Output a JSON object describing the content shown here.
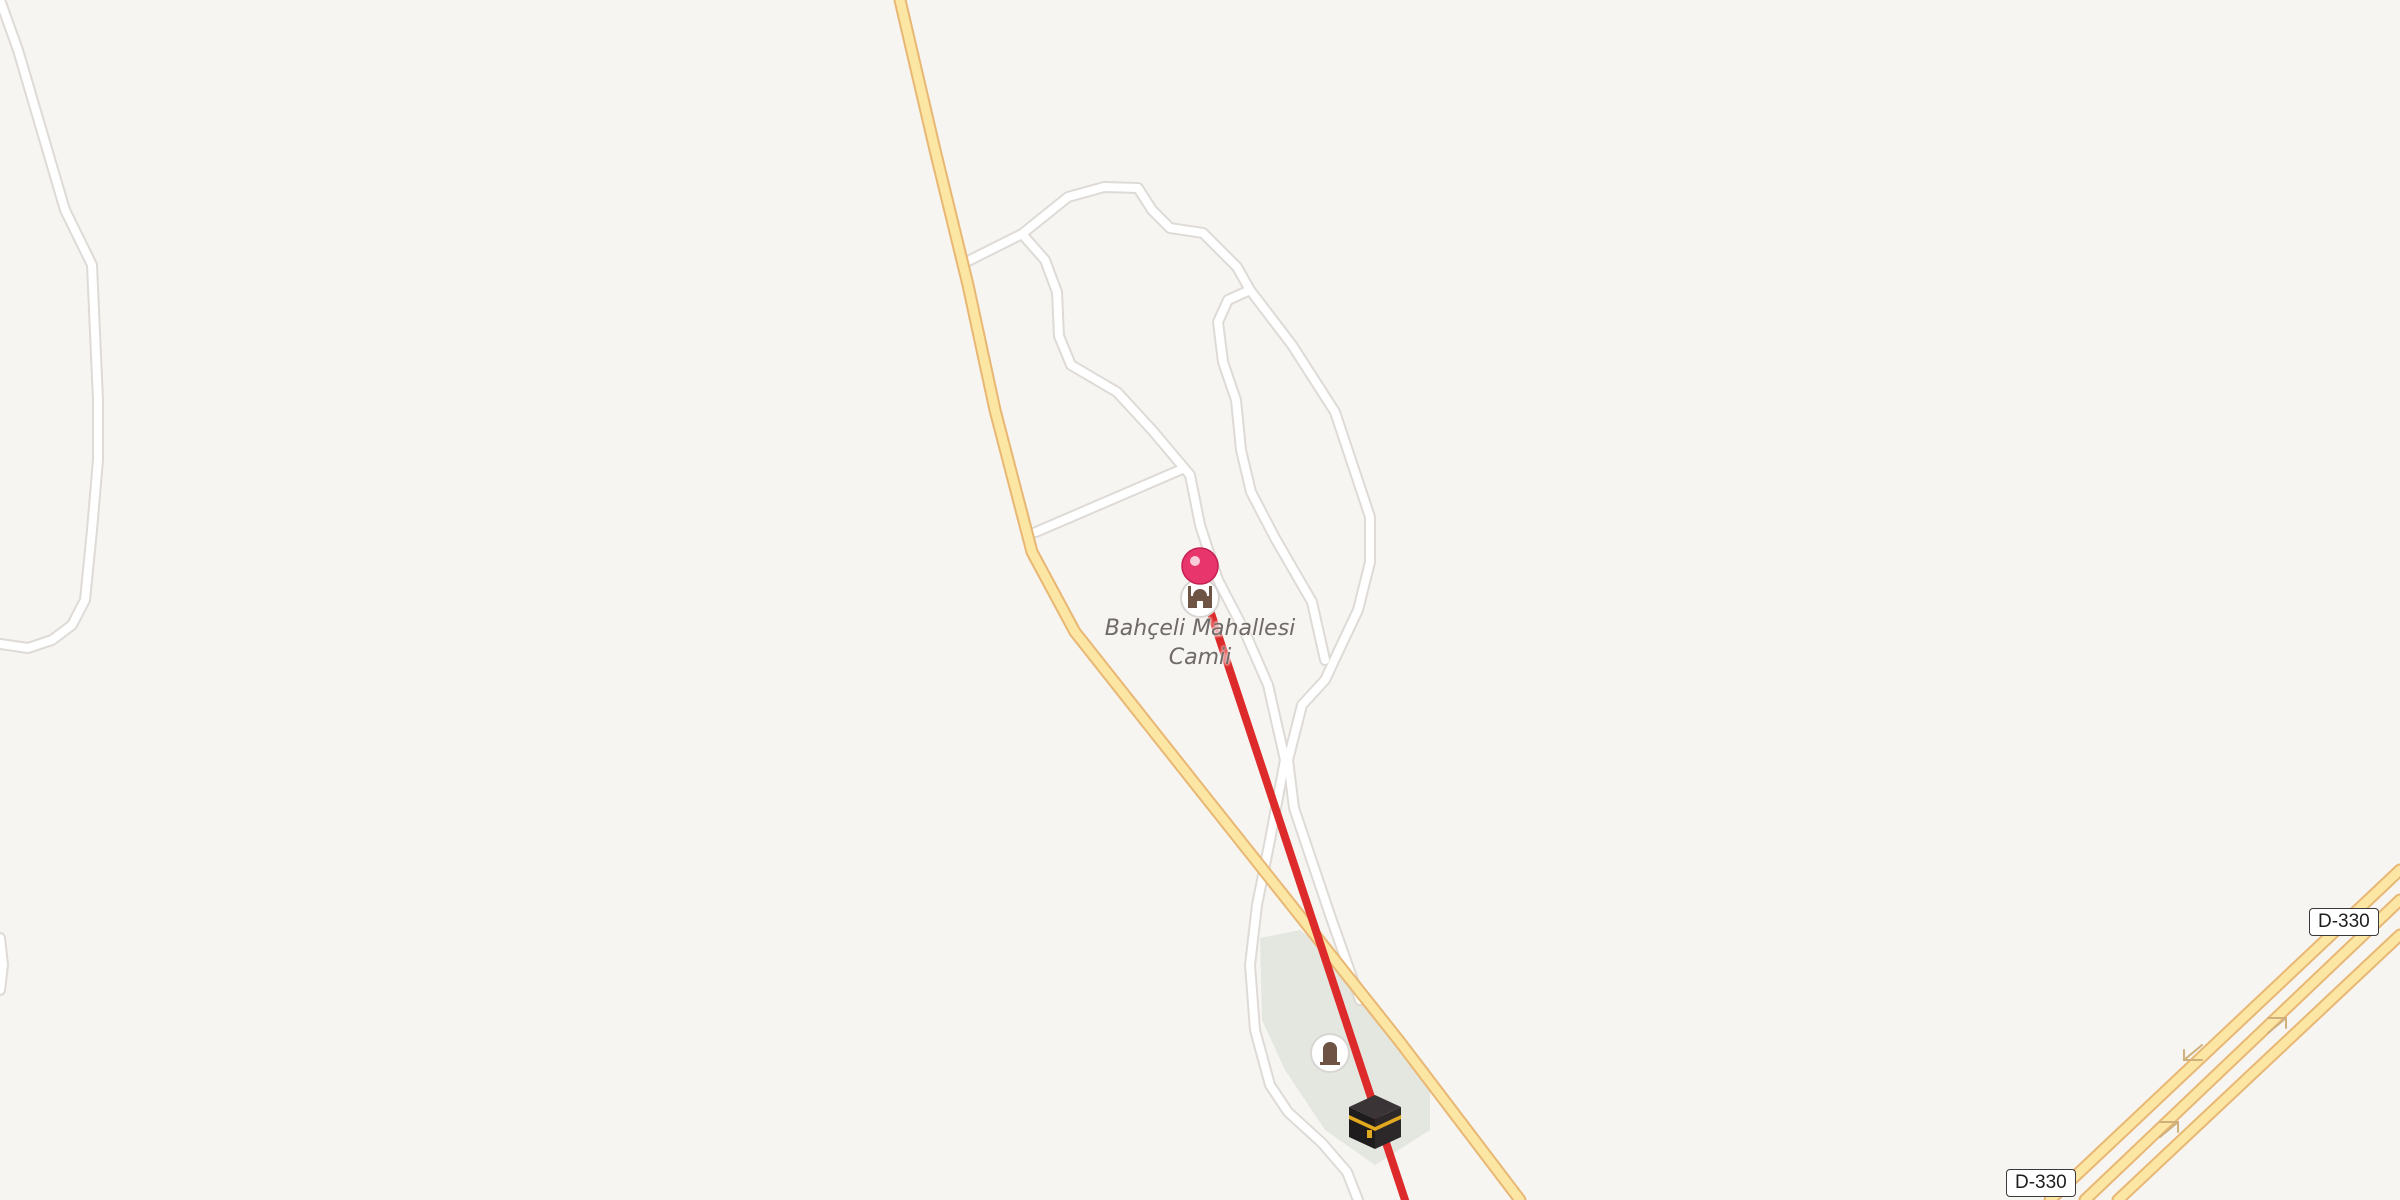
{
  "map": {
    "background_color": "#f7f5f2",
    "land_color": "#f7f5f2",
    "park_color": "#e4e6e0",
    "minor_road_color": "#ffffff",
    "minor_road_casing": "#dedad6",
    "major_road_color": "#fce6a4",
    "major_road_casing": "#e8b773",
    "route_color": "#dd2b2b",
    "marker_color": "#e8356b"
  },
  "poi": {
    "mosque": {
      "name_line1": "Bahçeli Mahallesi",
      "name_line2": "Camii",
      "icon": "mosque-icon"
    },
    "cemetery_icon": "cemetery-icon",
    "kaaba_icon": "kaaba-icon"
  },
  "road_shields": [
    {
      "label": "D-330"
    },
    {
      "label": "D-330"
    }
  ],
  "oneway_arrows_icon": "oneway-arrow-icon"
}
